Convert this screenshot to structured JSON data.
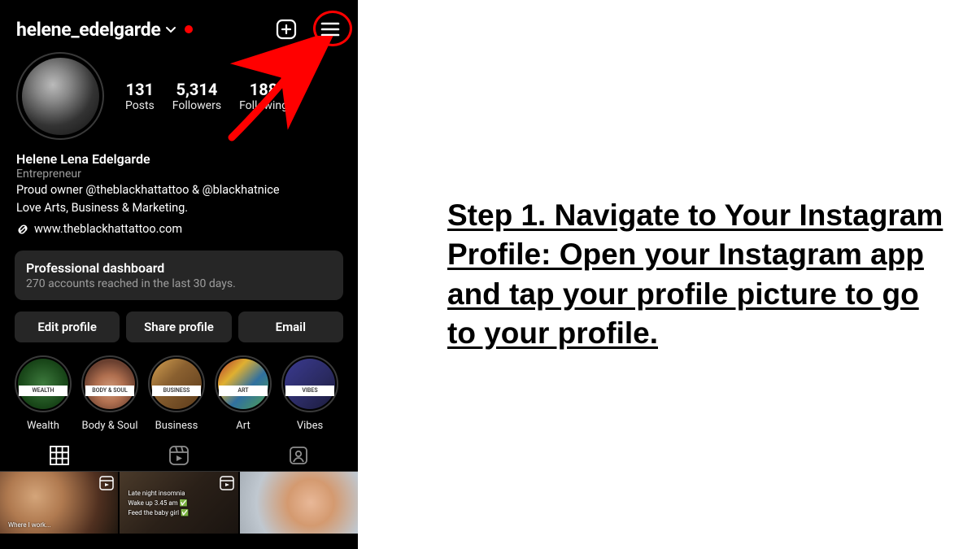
{
  "header": {
    "username": "helene_edelgarde"
  },
  "stats": {
    "posts": {
      "num": "131",
      "label": "Posts"
    },
    "followers": {
      "num": "5,314",
      "label": "Followers"
    },
    "following": {
      "num": "188",
      "label": "Following"
    }
  },
  "bio": {
    "name": "Helene Lena Edelgarde",
    "category": "Entrepreneur",
    "line1": "Proud owner @theblackhattattoo & @blackhatnice",
    "line2": "Love Arts, Business & Marketing.",
    "link": "www.theblackhattattoo.com"
  },
  "dashboard": {
    "title": "Professional dashboard",
    "subtitle": "270 accounts reached in the last 30 days."
  },
  "actions": {
    "edit": "Edit profile",
    "share": "Share profile",
    "email": "Email"
  },
  "highlights": [
    {
      "label": "Wealth",
      "banner": "WEALTH"
    },
    {
      "label": "Body & Soul",
      "banner": "BODY & SOUL"
    },
    {
      "label": "Business",
      "banner": "BUSINESS"
    },
    {
      "label": "Art",
      "banner": "ART"
    },
    {
      "label": "Vibes",
      "banner": "VIBES"
    }
  ],
  "grid": {
    "c1_caption": "Where I work...",
    "c2_line1": "Late night insomnia",
    "c2_line2": "Wake up 3.45 am ✅",
    "c2_line3": "Feed the baby girl ✅"
  },
  "instruction": "Step 1. Navigate to Your Instagram Profile: Open your Instagram app and tap your profile picture to go to your profile."
}
